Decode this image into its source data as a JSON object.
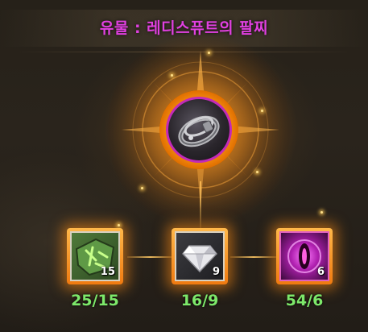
{
  "title": "유물 : 레디스퓨트의 팔찌",
  "colors": {
    "title": "#e040e0",
    "ratio": "#7de86a",
    "glow": "#ff9a1a",
    "relic_ring": "#c22ab8"
  },
  "relic": {
    "name": "레디스퓨트의 팔찌",
    "icon": "bracelet-icon"
  },
  "materials": [
    {
      "icon": "green-rune-stone-icon",
      "count": "15",
      "ratio": "25/15"
    },
    {
      "icon": "diamond-icon",
      "count": "9",
      "ratio": "16/9"
    },
    {
      "icon": "purple-eye-orb-icon",
      "count": "6",
      "ratio": "54/6"
    }
  ]
}
